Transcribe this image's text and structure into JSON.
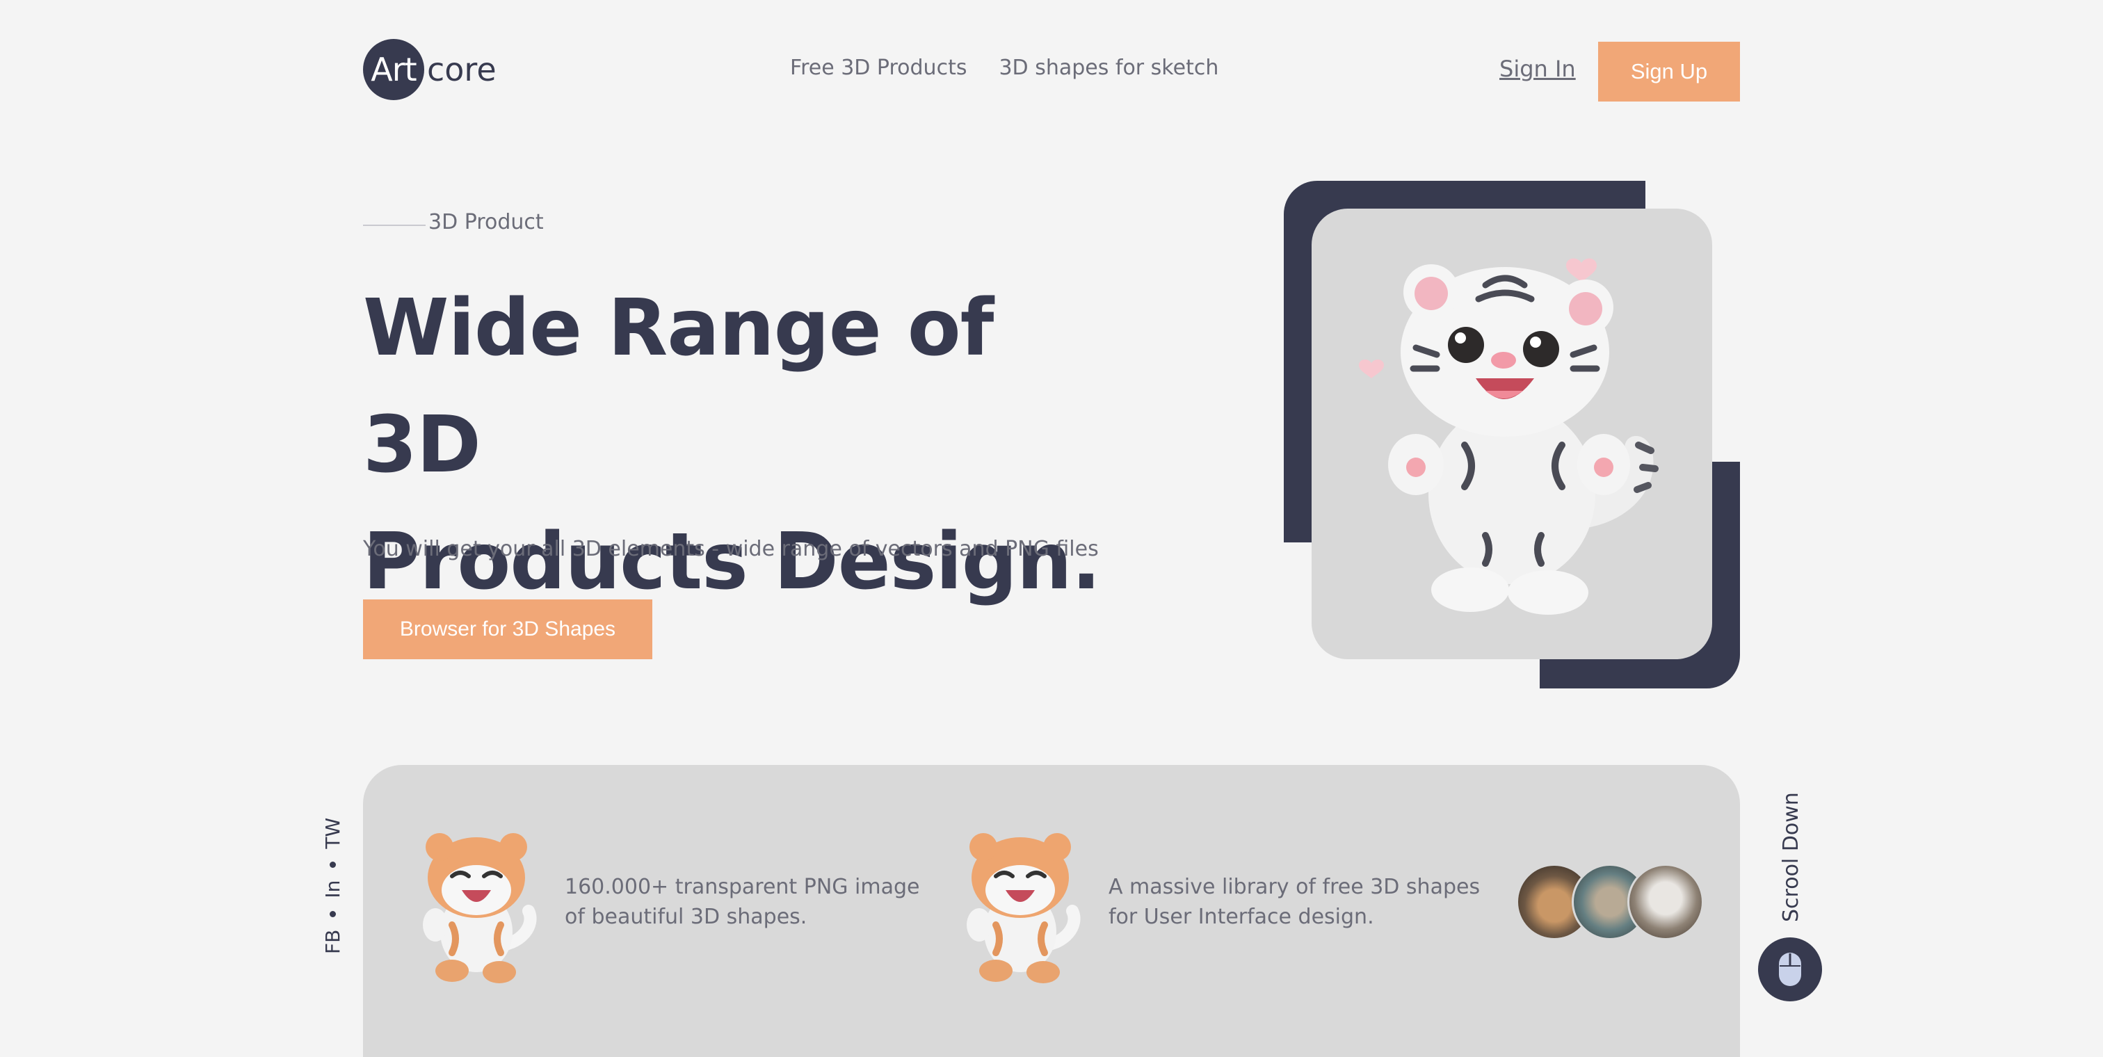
{
  "header": {
    "logo": {
      "badge": "Art",
      "rest": "core"
    },
    "nav": [
      {
        "label": "Free 3D Products"
      },
      {
        "label": "3D shapes for sketch"
      }
    ],
    "sign_in": "Sign In",
    "sign_up": "Sign Up"
  },
  "hero": {
    "eyebrow": "3D Product",
    "headline_line1": "Wide Range of 3D",
    "headline_line2": "Products Design.",
    "subtext": "You will get your all 3D elements - wide range of vectors and PNG files",
    "cta": "Browser for 3D Shapes"
  },
  "features": [
    {
      "line1": "160.000+ transparent PNG image",
      "line2": "of beautiful 3D shapes."
    },
    {
      "line1": "A massive library of free 3D shapes",
      "line2": "for User Interface design."
    }
  ],
  "social": {
    "fb": "FB",
    "in": "In",
    "tw": "TW"
  },
  "scroll": {
    "label": "Scrool Down"
  },
  "colors": {
    "accent": "#f1a777",
    "dark": "#373a4f",
    "background": "#f4f4f4",
    "band": "#d9d9d9"
  }
}
